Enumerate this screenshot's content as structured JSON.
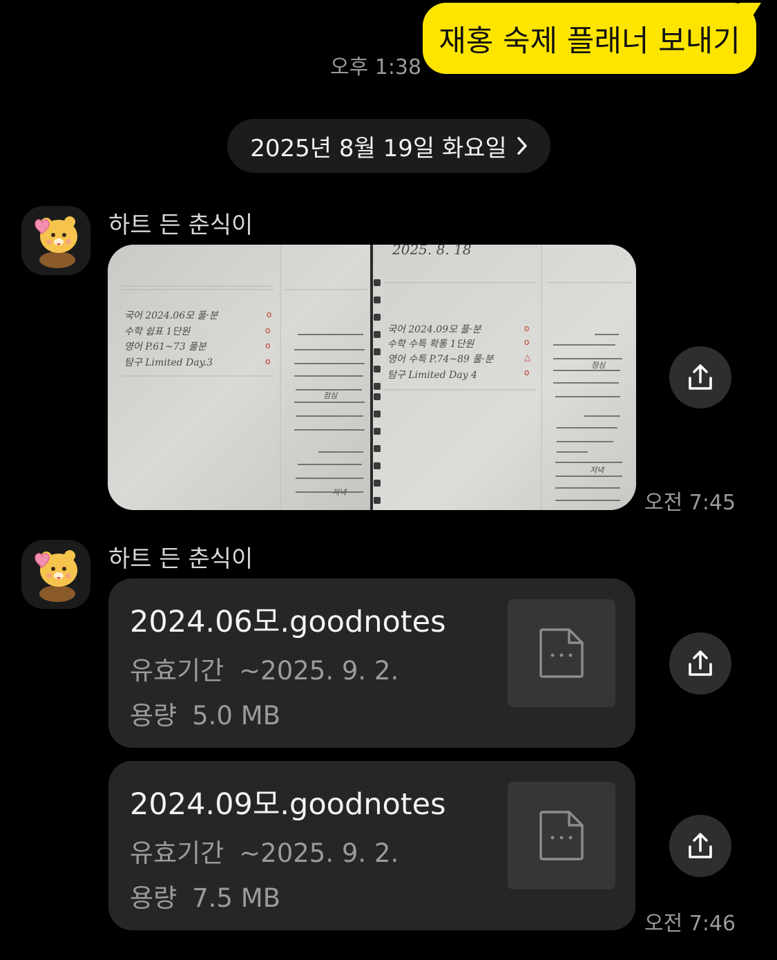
{
  "sent": {
    "message": "재홍 숙제 플래너 보내기",
    "time": "오후 1:38"
  },
  "date_divider": {
    "label": "2025년 8월 19일 화요일",
    "chevron": "›"
  },
  "messages": [
    {
      "sender": "하트 든 춘식이",
      "type": "photo",
      "time": "오전 7:45",
      "photo": {
        "left_page": {
          "rows": [
            "국어  2024.06모  풀·분",
            "수학  쉽표 1단원",
            "영어  P.61~73 풀분",
            "탐구  Limited  Day.3"
          ],
          "marks": [
            "o",
            "o",
            "o",
            "o"
          ],
          "side_note": "점심",
          "bottom_note": "저녁"
        },
        "right_page": {
          "header": "2025. 8. 18",
          "rows": [
            "국어  2024.09모  풀·분",
            "수학  수특 확통 1단원",
            "영어  수특 P.74~89  풀·분",
            "탐구  Limited  Day 4"
          ],
          "marks": [
            "o",
            "o",
            "△",
            "o"
          ],
          "side_note": "점심",
          "bottom_note": "저녁"
        }
      }
    },
    {
      "sender": "하트 든 춘식이",
      "type": "files",
      "time": "오전 7:46",
      "files": [
        {
          "name": "2024.06모.goodnotes",
          "expiry_label": "유효기간",
          "expiry_value": "~2025. 9. 2.",
          "size_label": "용량",
          "size_value": "5.0 MB"
        },
        {
          "name": "2024.09모.goodnotes",
          "expiry_label": "유효기간",
          "expiry_value": "~2025. 9. 2.",
          "size_label": "용량",
          "size_value": "7.5 MB"
        }
      ]
    }
  ],
  "icons": {
    "share": "share-icon",
    "file": "file-icon",
    "avatar": "choonsik-avatar-icon"
  },
  "colors": {
    "accent": "#FEE500",
    "background": "#000000",
    "card": "#262628"
  }
}
